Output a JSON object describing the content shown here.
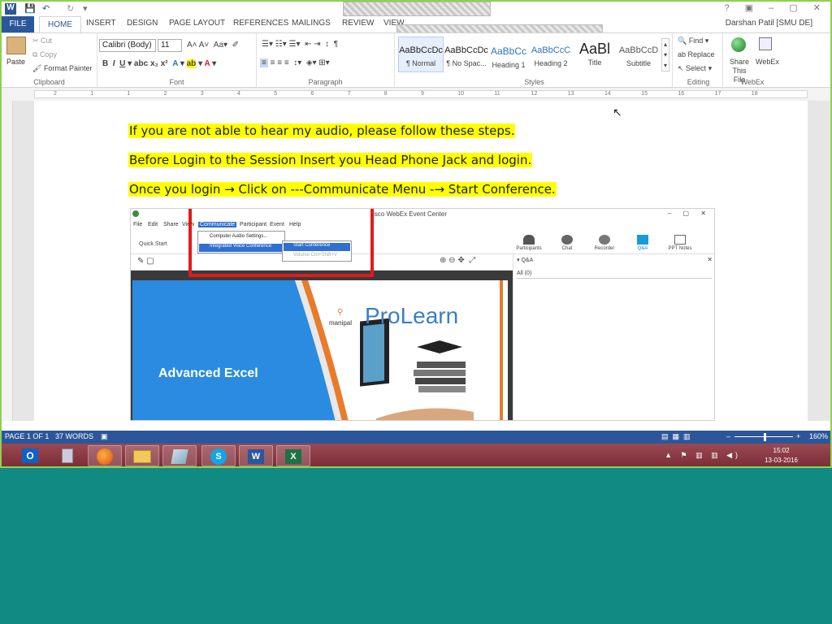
{
  "window": {
    "user": "Darshan Patil [SMU DE]"
  },
  "tabs": [
    {
      "label": "FILE"
    },
    {
      "label": "HOME"
    },
    {
      "label": "INSERT"
    },
    {
      "label": "DESIGN"
    },
    {
      "label": "PAGE LAYOUT"
    },
    {
      "label": "REFERENCES"
    },
    {
      "label": "MAILINGS"
    },
    {
      "label": "REVIEW"
    },
    {
      "label": "VIEW"
    }
  ],
  "ribbon": {
    "clipboard": {
      "label": "Clipboard",
      "paste": "Paste",
      "cut": "Cut",
      "copy": "Copy",
      "format_painter": "Format Painter"
    },
    "font": {
      "label": "Font",
      "name": "Calibri (Body)",
      "size": "11"
    },
    "paragraph": {
      "label": "Paragraph"
    },
    "styles": {
      "label": "Styles",
      "items": [
        {
          "preview": "AaBbCcDc",
          "name": "¶ Normal"
        },
        {
          "preview": "AaBbCcDc",
          "name": "¶ No Spac..."
        },
        {
          "preview": "AaBbCc",
          "name": "Heading 1"
        },
        {
          "preview": "AaBbCcC",
          "name": "Heading 2"
        },
        {
          "preview": "AaBl",
          "name": "Title"
        },
        {
          "preview": "AaBbCcD",
          "name": "Subtitle"
        }
      ]
    },
    "editing": {
      "label": "Editing",
      "find": "Find",
      "replace": "Replace",
      "select": "Select"
    },
    "webex": {
      "label": "WebEx",
      "share": "Share This File",
      "webex": "WebEx"
    }
  },
  "ruler": {
    "marks": [
      "2",
      "1",
      "1",
      "2",
      "3",
      "4",
      "5",
      "6",
      "7",
      "8",
      "9",
      "10",
      "11",
      "12",
      "13",
      "14",
      "15",
      "16",
      "17",
      "18"
    ]
  },
  "document": {
    "lines": [
      "If you are not able to hear my audio, please follow these steps.",
      "Before Login to the Session Insert you Head Phone Jack and login.",
      "Once you login → Click on ---Communicate Menu -→ Start Conference."
    ]
  },
  "embedded": {
    "title": "isco WebEx Event Center",
    "menu": [
      "File",
      "Edit",
      "Share",
      "View",
      "Communicate",
      "Participant",
      "Event",
      "Help"
    ],
    "quick_start": "Quick Start",
    "dropdown": [
      "Computer Audio Settings...",
      "Integrated Voice Conference"
    ],
    "submenu": [
      "Start Conference",
      "Volume    Ctrl+Shift+V"
    ],
    "toolbar": [
      "Participants",
      "Chat",
      "Recorder",
      "Q&A",
      "PPT Notes"
    ],
    "qa_title": "Q&A",
    "qa_tab": "All (0)",
    "slide_brand_small": "manipal",
    "slide_brand": "ProLearn",
    "slide_title": "Advanced Excel"
  },
  "status": {
    "page": "PAGE 1 OF 1",
    "words": "37 WORDS",
    "zoom": "160%"
  },
  "taskbar": {
    "time": "15:02",
    "date": "13-03-2016"
  },
  "colors": {
    "word_blue": "#2b579a",
    "highlight": "#ffff00",
    "desktop": "#108a82",
    "red_box": "#e01b1b"
  }
}
